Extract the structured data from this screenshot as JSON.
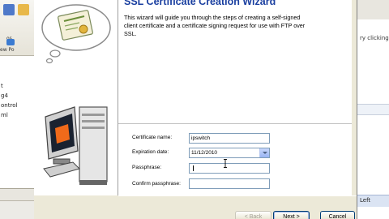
{
  "background_app": {
    "left_toolbar_labels": [
      "os",
      "ew Po"
    ],
    "left_tree_items": [
      "t",
      "g4",
      "ontrol",
      "ml"
    ],
    "right_hint": "ry clicking",
    "right_status": "Left"
  },
  "wizard": {
    "title": "SSL Certificate Creation Wizard",
    "description": "This wizard will guide you through the steps of creating a self-signed client certificate and a certificate signing request for use with FTP over SSL.",
    "fields": {
      "certificate_name": {
        "label": "Certificate name:",
        "value": "ipswitch"
      },
      "expiration_date": {
        "label": "Expiration date:",
        "value": "11/12/2010"
      },
      "passphrase": {
        "label": "Passphrase:",
        "value": ""
      },
      "confirm_passphrase": {
        "label": "Confirm passphrase:",
        "value": ""
      }
    },
    "buttons": {
      "back": "< Back",
      "next": "Next >",
      "cancel": "Cancel"
    }
  },
  "icons": [
    "certificate-cloud-icon",
    "computer-icon",
    "combo-arrow-icon",
    "text-cursor-icon"
  ],
  "colors": {
    "title_blue": "#1a3fa0",
    "dialog_face": "#ece9d8",
    "field_border": "#7f9db9",
    "button_border": "#003c74"
  }
}
